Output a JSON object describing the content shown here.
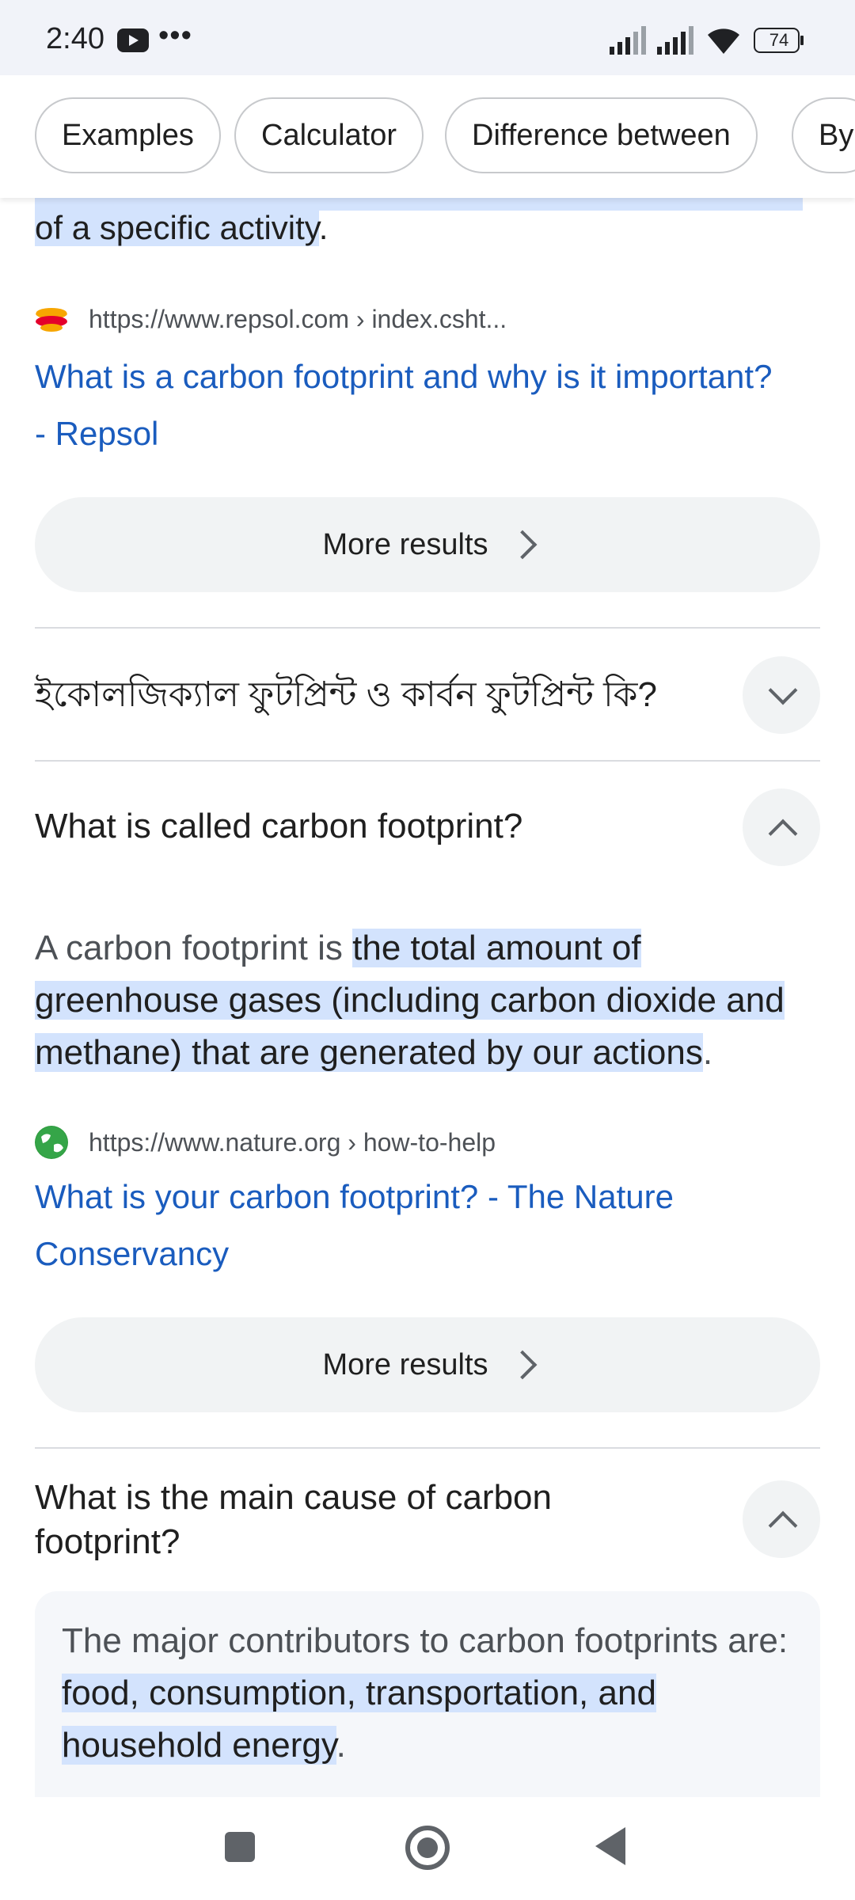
{
  "status_bar": {
    "time": "2:40",
    "more": "•••",
    "battery": "74",
    "icons": [
      "youtube-icon",
      "signal-icon",
      "signal-icon",
      "wifi-icon",
      "battery-icon"
    ]
  },
  "chips": [
    "Examples",
    "Calculator",
    "Difference between",
    "By"
  ],
  "top_snippet": {
    "highlight": "of a specific activity",
    "tail": "."
  },
  "result1": {
    "url": "https://www.repsol.com › index.csht...",
    "title": "What is a carbon footprint and why is it important? - Repsol"
  },
  "more_results_label": "More results",
  "q1": {
    "title": "ইকোলজিক্যাল ফুটপ্রিন্ট ও কার্বন ফুটপ্রিন্ট কি?"
  },
  "q2": {
    "title": "What is called carbon footprint?",
    "answer_prefix": "A carbon footprint is ",
    "answer_highlight": "the total amount of greenhouse gases (including carbon dioxide and methane) that are generated by our actions",
    "answer_suffix": ".",
    "url": "https://www.nature.org › how-to-help",
    "link": "What is your carbon footprint? - The Nature Conservancy"
  },
  "q3": {
    "title": "What is the main cause of carbon footprint?",
    "answer_prefix": "The major contributors to carbon footprints are: ",
    "answer_highlight": "food, consumption, transportation, and household energy",
    "answer_suffix": "."
  },
  "colors": {
    "link": "#1a5cbe",
    "highlight": "#d3e3fd",
    "chip_border": "#c7c9cc",
    "button_bg": "#f1f3f4"
  }
}
